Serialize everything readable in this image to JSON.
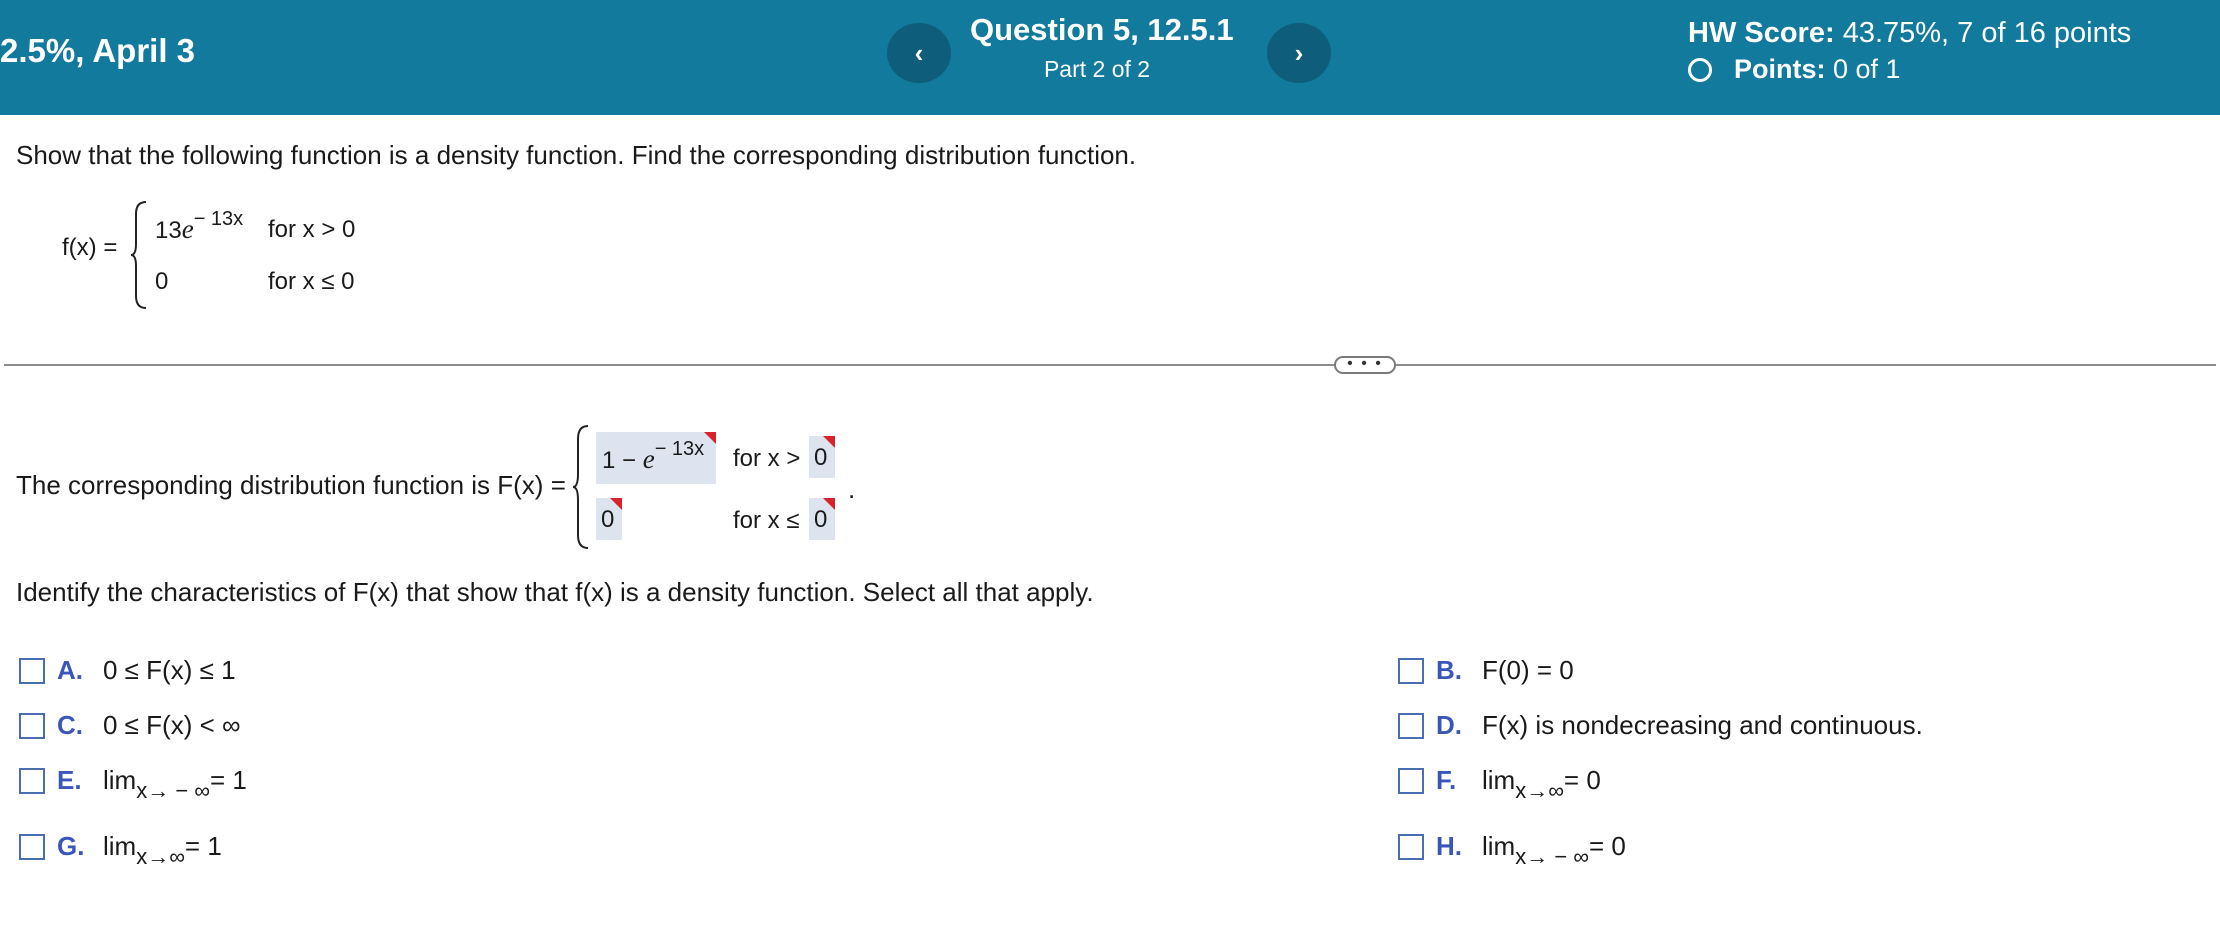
{
  "header": {
    "left_text": "2.5%, April 3",
    "prev_label": "‹",
    "next_label": "›",
    "question_title": "Question 5, 12.5.1",
    "question_part": "Part 2 of 2",
    "hw_score_label": "HW Score:",
    "hw_score_value": "43.75%, 7 of 16 points",
    "points_label": "Points:",
    "points_value": "0 of 1"
  },
  "problem": {
    "prompt": "Show that the following function is a density function. Find the corresponding distribution function.",
    "f_label": "f(x) =",
    "case1_coef": "13",
    "case1_e": "e",
    "case1_exp": "− 13x",
    "case1_cond": "for x > 0",
    "case2_value": "0",
    "case2_cond": "for x ≤ 0"
  },
  "divider": {
    "button_label": "• • •"
  },
  "answer": {
    "text": "The corresponding distribution function is F(x) =",
    "box1_prefix": "1 − ",
    "box1_e": "e",
    "box1_exp": "− 13x",
    "cond1_text": "for x >",
    "box2_value": "0",
    "box3_value": "0",
    "cond2_text": "for x ≤",
    "box4_value": "0",
    "period": "."
  },
  "question2": {
    "text": "Identify the characteristics of F(x) that show that f(x) is a density function. Select all that apply."
  },
  "options": [
    {
      "letter": "A.",
      "text": "0 ≤ F(x) ≤ 1"
    },
    {
      "letter": "B.",
      "text": "F(0) = 0"
    },
    {
      "letter": "C.",
      "text": "0 ≤ F(x) < ∞"
    },
    {
      "letter": "D.",
      "text": "F(x) is nondecreasing and continuous."
    },
    {
      "letter": "E.",
      "lim": "lim",
      "sub": "x→ − ∞",
      "rest": " = 1"
    },
    {
      "letter": "F.",
      "lim": "lim",
      "sub": "x→∞",
      "rest": " = 0"
    },
    {
      "letter": "G.",
      "lim": "lim",
      "sub": "x→∞",
      "rest": " = 1"
    },
    {
      "letter": "H.",
      "lim": "lim",
      "sub": "x→ − ∞",
      "rest": " = 0"
    }
  ]
}
